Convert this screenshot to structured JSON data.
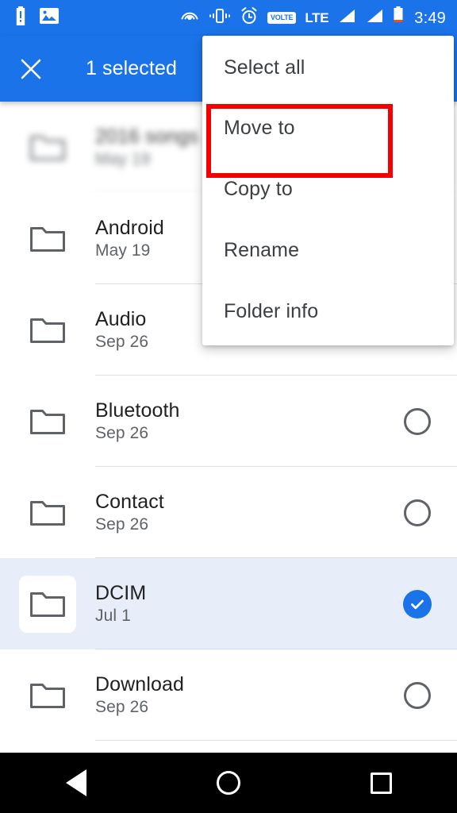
{
  "status_bar": {
    "left_icons": [
      {
        "name": "battery-alert-icon",
        "label": "battery-alert"
      },
      {
        "name": "photo-icon",
        "label": "photo"
      }
    ],
    "right_icons": [
      {
        "name": "hotspot-icon",
        "label": "hotspot"
      },
      {
        "name": "vibrate-icon",
        "label": "vibrate"
      },
      {
        "name": "alarm-icon",
        "label": "alarm"
      }
    ],
    "volte_label": "VOLTE",
    "network_label": "LTE",
    "signal_bars": 2,
    "battery": "low",
    "time": "3:49",
    "background_color": "#1a73e8"
  },
  "app_bar": {
    "close_icon": "close-icon",
    "title": "1 selected",
    "background_color": "#1a73e8",
    "text_color": "#ffffff"
  },
  "menu": {
    "items": [
      {
        "label": "Select all",
        "highlighted": false
      },
      {
        "label": "Move to",
        "highlighted": true
      },
      {
        "label": "Copy to",
        "highlighted": false
      },
      {
        "label": "Rename",
        "highlighted": false
      },
      {
        "label": "Folder info",
        "highlighted": false
      }
    ],
    "highlight_color": "#f40000"
  },
  "file_list": {
    "rows": [
      {
        "name": "2016 songs",
        "date": "May 19",
        "selected": false,
        "blurred": true,
        "checkbox": "hidden"
      },
      {
        "name": "Android",
        "date": "May 19",
        "selected": false,
        "blurred": false,
        "checkbox": "hidden"
      },
      {
        "name": "Audio",
        "date": "Sep 26",
        "selected": false,
        "blurred": false,
        "checkbox": "hidden"
      },
      {
        "name": "Bluetooth",
        "date": "Sep 26",
        "selected": false,
        "blurred": false,
        "checkbox": "empty"
      },
      {
        "name": "Contact",
        "date": "Sep 26",
        "selected": false,
        "blurred": false,
        "checkbox": "empty"
      },
      {
        "name": "DCIM",
        "date": "Jul 1",
        "selected": true,
        "blurred": false,
        "checkbox": "checked"
      },
      {
        "name": "Download",
        "date": "Sep 26",
        "selected": false,
        "blurred": false,
        "checkbox": "empty"
      }
    ],
    "folder_icon": "folder-icon",
    "selected_row_color": "#e8eef9",
    "checked_color": "#1a73e8"
  },
  "nav_bar": {
    "back": "back-triangle-icon",
    "home": "home-circle-icon",
    "recents": "recents-square-icon",
    "background_color": "#000000"
  }
}
